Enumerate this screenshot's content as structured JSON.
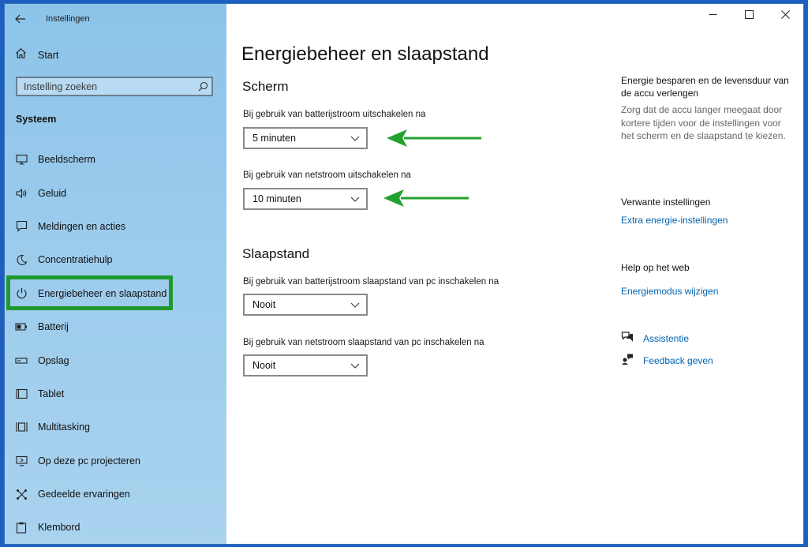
{
  "window": {
    "title": "Instellingen"
  },
  "sidebar": {
    "home_label": "Start",
    "search_placeholder": "Instelling zoeken",
    "section_label": "Systeem",
    "items": [
      {
        "label": "Beeldscherm",
        "icon": "monitor-icon"
      },
      {
        "label": "Geluid",
        "icon": "speaker-icon"
      },
      {
        "label": "Meldingen en acties",
        "icon": "notification-icon"
      },
      {
        "label": "Concentratiehulp",
        "icon": "moon-icon"
      },
      {
        "label": "Energiebeheer en slaapstand",
        "icon": "power-icon",
        "active": true
      },
      {
        "label": "Batterij",
        "icon": "battery-icon"
      },
      {
        "label": "Opslag",
        "icon": "storage-icon"
      },
      {
        "label": "Tablet",
        "icon": "tablet-icon"
      },
      {
        "label": "Multitasking",
        "icon": "multitasking-icon"
      },
      {
        "label": "Op deze pc projecteren",
        "icon": "project-icon"
      },
      {
        "label": "Gedeelde ervaringen",
        "icon": "shared-experiences-icon"
      },
      {
        "label": "Klembord",
        "icon": "clipboard-icon"
      }
    ]
  },
  "main": {
    "title": "Energiebeheer en slaapstand",
    "screen": {
      "heading": "Scherm",
      "battery_label": "Bij gebruik van batterijstroom uitschakelen na",
      "battery_value": "5 minuten",
      "plugged_label": "Bij gebruik van netstroom uitschakelen na",
      "plugged_value": "10 minuten"
    },
    "sleep": {
      "heading": "Slaapstand",
      "battery_label": "Bij gebruik van batterijstroom slaapstand van pc inschakelen na",
      "battery_value": "Nooit",
      "plugged_label": "Bij gebruik van netstroom slaapstand van pc inschakelen na",
      "plugged_value": "Nooit"
    }
  },
  "side_panel": {
    "tip_title": "Energie besparen en de levensduur van de accu verlengen",
    "tip_text": "Zorg dat de accu langer meegaat door kortere tijden voor de instellingen voor het scherm en de slaapstand te kiezen.",
    "related_title": "Verwante instellingen",
    "related_link": "Extra energie-instellingen",
    "web_help_title": "Help op het web",
    "web_help_link": "Energiemodus wijzigen",
    "assist_label": "Assistentie",
    "feedback_label": "Feedback geven"
  },
  "colors": {
    "highlight_border": "#1e9a2f",
    "annotation_arrow": "#23a12f",
    "link": "#0063b1",
    "sidebar_bg": "#9ccbec"
  }
}
